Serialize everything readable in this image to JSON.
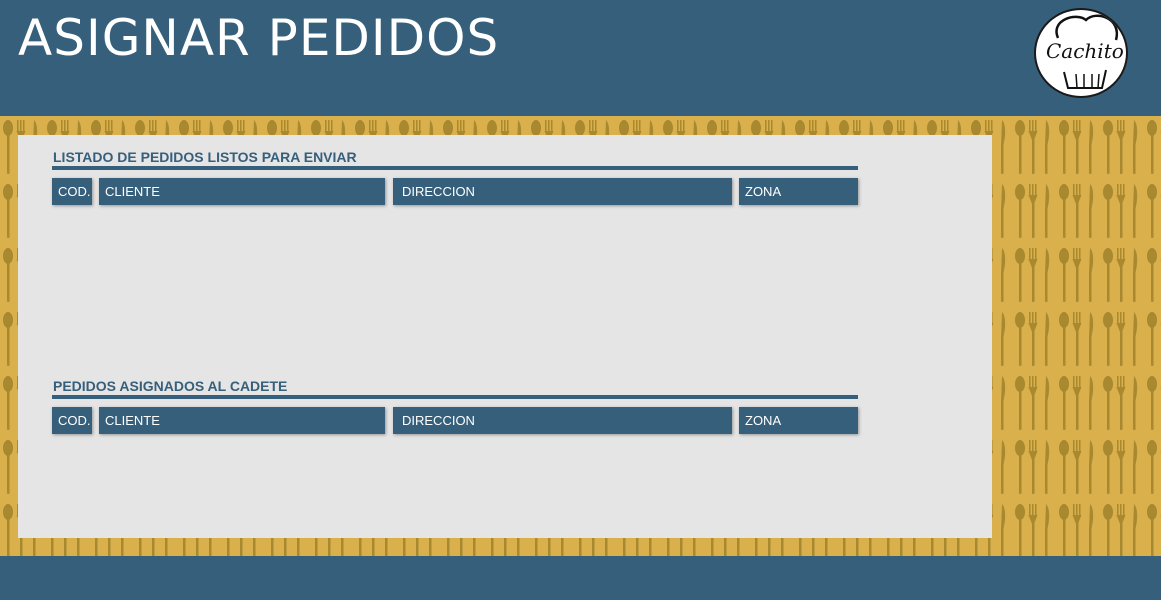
{
  "header": {
    "title": "ASIGNAR PEDIDOS",
    "logo_text": "Cachito",
    "logo_icon": "chef-hat-icon"
  },
  "background": {
    "pattern_icon": "cutlery-pattern-icon",
    "colors": {
      "primary": "#365f7c",
      "pattern": "#d9b04b",
      "panel": "#e5e5e5"
    }
  },
  "sections": {
    "ready": {
      "title": "LISTADO DE PEDIDOS LISTOS PARA ENVIAR",
      "columns": [
        "COD.",
        "CLIENTE",
        "DIRECCION",
        "ZONA"
      ],
      "rows": []
    },
    "assigned": {
      "title": "PEDIDOS ASIGNADOS AL CADETE",
      "columns": [
        "COD.",
        "CLIENTE",
        "DIRECCION",
        "ZONA"
      ],
      "rows": []
    }
  }
}
